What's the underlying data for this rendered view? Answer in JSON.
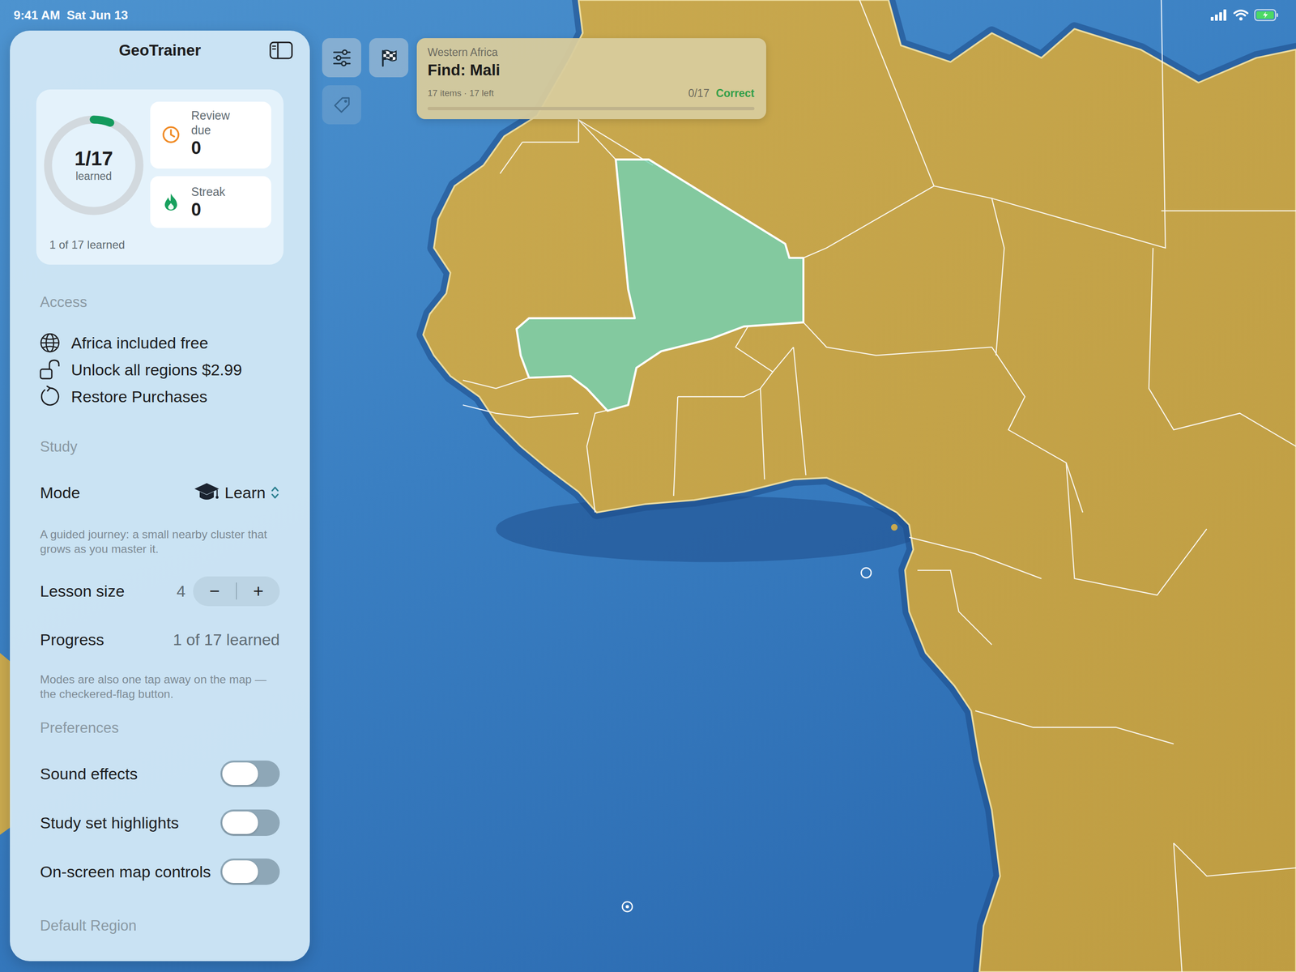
{
  "status_bar": {
    "time": "9:41 AM",
    "date": "Sat Jun 13"
  },
  "sidebar": {
    "title": "GeoTrainer",
    "stats": {
      "ring_value": "1/17",
      "ring_label": "learned",
      "ring_level": 0.0588,
      "review": {
        "label": "Review due",
        "value": "0"
      },
      "streak": {
        "label": "Streak",
        "value": "0"
      },
      "summary": "1 of 17 learned"
    },
    "access": {
      "header": "Access",
      "items": [
        {
          "label": "Africa included free"
        },
        {
          "label": "Unlock all regions $2.99"
        },
        {
          "label": "Restore Purchases"
        }
      ]
    },
    "study": {
      "header": "Study",
      "mode": {
        "label": "Mode",
        "value": "Learn"
      },
      "description": "A guided journey: a small nearby cluster that grows as you master it.",
      "lesson_size": {
        "label": "Lesson size",
        "value": "4",
        "decrement": "−",
        "increment": "+"
      },
      "progress": {
        "label": "Progress",
        "value": "1 of 17 learned"
      },
      "note": "Modes are also one tap away on the map — the checkered-flag button."
    },
    "preferences": {
      "header": "Preferences",
      "toggles": [
        {
          "label": "Sound effects",
          "on": false
        },
        {
          "label": "Study set highlights",
          "on": false
        },
        {
          "label": "On-screen map controls",
          "on": false
        }
      ]
    },
    "default_region": {
      "header": "Default Region"
    }
  },
  "prompt": {
    "region": "Western Africa",
    "title": "Find: Mali",
    "meta": "17 items · 17 left",
    "score": "0/17",
    "feedback": "Correct",
    "level": 0
  },
  "toolbar": {
    "filters": {
      "disabled": false
    },
    "modes": {
      "disabled": false
    },
    "tags": {
      "disabled": true
    }
  }
}
